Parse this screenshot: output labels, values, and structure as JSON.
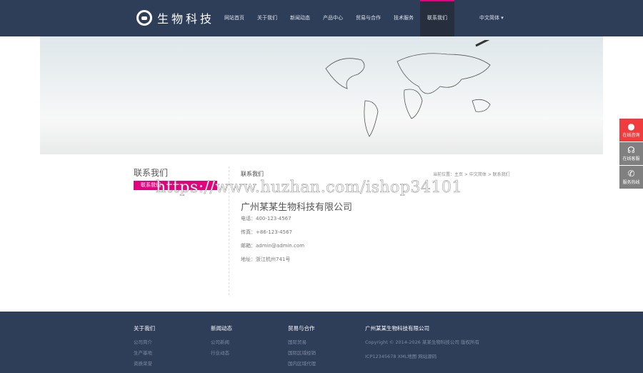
{
  "header": {
    "logo": "生物科技",
    "nav": [
      "网站首页",
      "关于我们",
      "新闻动态",
      "产品中心",
      "贸易与合作",
      "技术服务",
      "联系我们"
    ],
    "active_index": 6,
    "lang": "中文简体 ▾"
  },
  "sidebar": {
    "title": "联系我们",
    "item": "联系我们"
  },
  "content": {
    "title": "联系我们",
    "breadcrumb": "当前位置：主页 > 中文简体 > 联系我们",
    "company": "广州某某生物科技有限公司",
    "phone": "电话：400-123-4567",
    "fax": "传真：+86-123-4567",
    "email": "邮箱：admin@admin.com",
    "address": "地址：浙江杭州741号"
  },
  "watermark": "https://www.huzhan.com/ishop34101",
  "float": {
    "items": [
      "在线咨询",
      "在线客服",
      "服务热线"
    ],
    "colors": [
      "#f03c3c",
      "#808080",
      "#808080"
    ]
  },
  "footer": {
    "cols": [
      {
        "title": "关于我们",
        "links": [
          "公司简介",
          "生产基地",
          "资质荣誉"
        ]
      },
      {
        "title": "新闻动态",
        "links": [
          "公司新闻",
          "行业动态"
        ]
      },
      {
        "title": "贸易与合作",
        "links": [
          "国际贸易",
          "国际区域经销",
          "国内区域代理"
        ]
      }
    ],
    "company": "广州某某生物科技有限公司",
    "copyright": "Copyright © 2014-2026 某某生物科技公司 版权所有",
    "icp": "ICP12345678  XML地图  网站源码"
  }
}
